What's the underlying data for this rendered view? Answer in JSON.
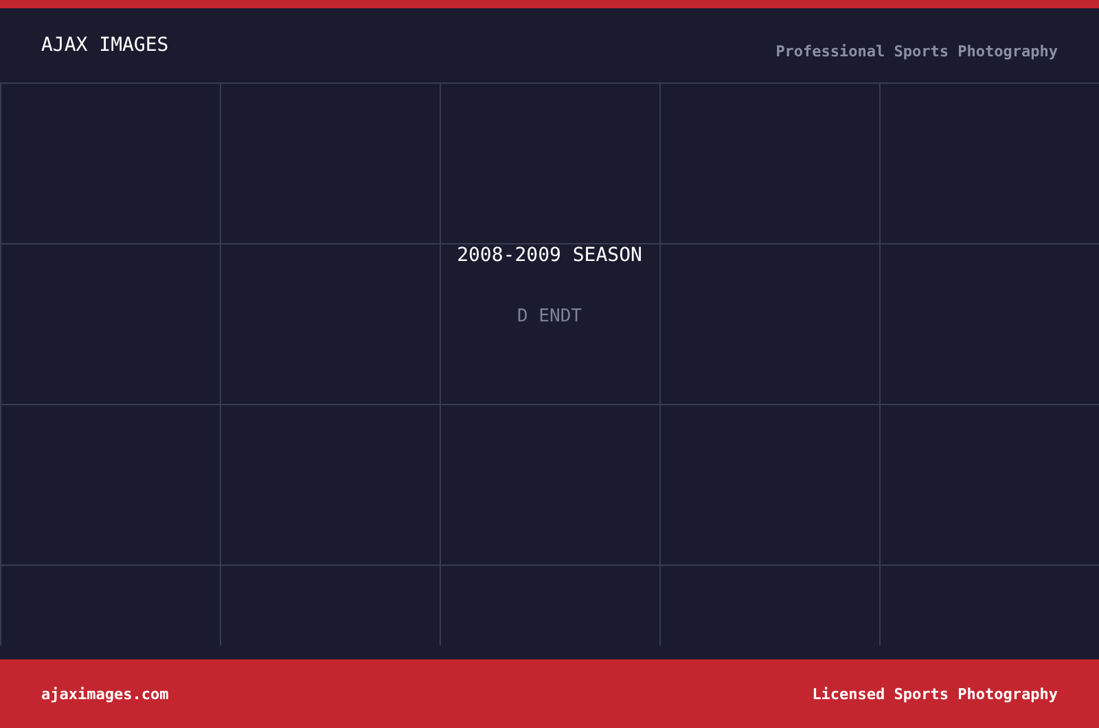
{
  "header": {
    "title": "AJAX IMAGES",
    "tagline": "Professional Sports Photography"
  },
  "content": {
    "heading": "2008-2009 SEASON",
    "subheading": "D ENDT"
  },
  "footer": {
    "site": "ajaximages.com",
    "tagline": "Licensed Sports Photography"
  }
}
